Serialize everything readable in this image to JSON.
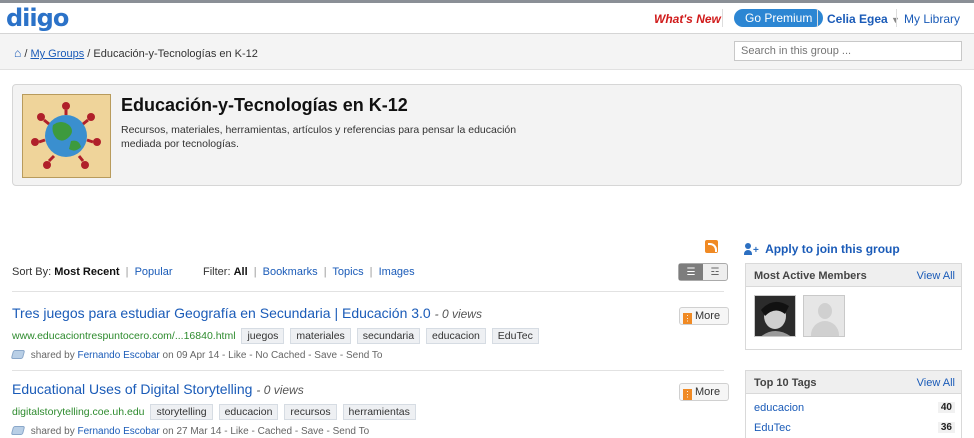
{
  "topbar": {
    "logo": "diigo",
    "whats_new": "What's New",
    "go_premium": "Go Premium",
    "user": "Celia Egea",
    "user_arrow": "▼",
    "my_library": "My Library"
  },
  "breadcrumb": {
    "sep1": "/",
    "my_groups": "My Groups",
    "sep2": "/",
    "current": "Educación-y-Tecnologías en K-12"
  },
  "search": {
    "placeholder": "Search in this group ..."
  },
  "group": {
    "title": "Educación-y-Tecnologías en K-12",
    "description": "Recursos, materiales, herramientas, artículos y referencias para pensar la educación mediada por tecnologías."
  },
  "sort": {
    "label": "Sort By:",
    "most_recent": "Most Recent",
    "popular": "Popular",
    "filter_label": "Filter:",
    "filters": [
      "All",
      "Bookmarks",
      "Topics",
      "Images"
    ]
  },
  "bookmarks": [
    {
      "title": "Tres juegos para estudiar Geografía en Secundaria | Educación 3.0",
      "views": "- 0 views",
      "url": "www.educaciontrespuntocero.com/...16840.html",
      "tags": [
        "juegos",
        "materiales",
        "secundaria",
        "educacion",
        "EduTec"
      ],
      "shared_prefix": "shared by",
      "sharer": "Fernando Escobar",
      "shared_suffix": "on 09 Apr 14  - Like - No Cached - Save - Send To",
      "more": "More"
    },
    {
      "title": "Educational Uses of Digital Storytelling",
      "views": "- 0 views",
      "url": "digitalstorytelling.coe.uh.edu",
      "tags": [
        "storytelling",
        "educacion",
        "recursos",
        "herramientas"
      ],
      "shared_prefix": "shared by",
      "sharer": "Fernando Escobar",
      "shared_suffix": "on 27 Mar 14  - Like - Cached - Save - Send To",
      "more": "More"
    }
  ],
  "sidebar": {
    "join": "Apply to join this group",
    "members": {
      "title": "Most Active Members",
      "view_all": "View All"
    },
    "tags": {
      "title": "Top 10 Tags",
      "view_all": "View All",
      "items": [
        {
          "name": "educacion",
          "count": "40"
        },
        {
          "name": "EduTec",
          "count": "36"
        }
      ]
    }
  },
  "colors": {
    "link": "#1a5bb8",
    "premium": "#2c86d3",
    "whats_new": "#d01a1a",
    "url": "#2e8b2e"
  }
}
